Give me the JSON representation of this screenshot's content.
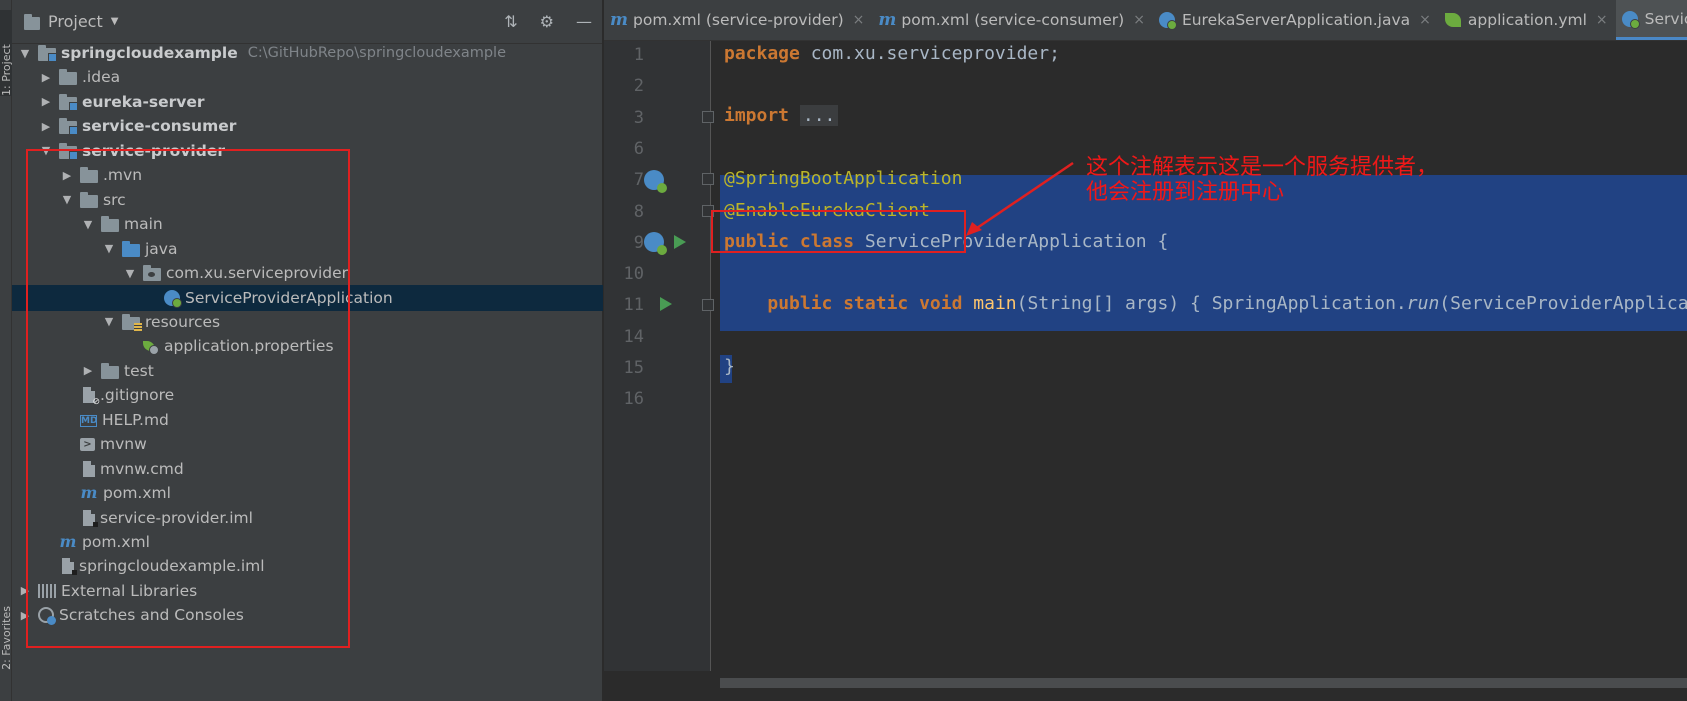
{
  "side_strip": {
    "project_tab": "1: Project",
    "favorites_tab": "2: Favorites"
  },
  "project_panel": {
    "title": "Project",
    "tree": [
      {
        "depth": 0,
        "arrow": "down",
        "icon": "folder-module",
        "label": "springcloudexample",
        "bold": true,
        "path": "C:\\GitHubRepo\\springcloudexample"
      },
      {
        "depth": 1,
        "arrow": "right",
        "icon": "folder",
        "label": ".idea"
      },
      {
        "depth": 1,
        "arrow": "right",
        "icon": "folder-module",
        "label": "eureka-server",
        "bold": true
      },
      {
        "depth": 1,
        "arrow": "right",
        "icon": "folder-module",
        "label": "service-consumer",
        "bold": true
      },
      {
        "depth": 1,
        "arrow": "down",
        "icon": "folder-module",
        "label": "service-provider",
        "bold": true
      },
      {
        "depth": 2,
        "arrow": "right",
        "icon": "folder",
        "label": ".mvn"
      },
      {
        "depth": 2,
        "arrow": "down",
        "icon": "folder",
        "label": "src"
      },
      {
        "depth": 3,
        "arrow": "down",
        "icon": "folder",
        "label": "main"
      },
      {
        "depth": 4,
        "arrow": "down",
        "icon": "folder-blue",
        "label": "java"
      },
      {
        "depth": 5,
        "arrow": "down",
        "icon": "folder-package",
        "label": "com.xu.serviceprovider"
      },
      {
        "depth": 6,
        "arrow": "",
        "icon": "spring",
        "label": "ServiceProviderApplication",
        "selected": true
      },
      {
        "depth": 4,
        "arrow": "down",
        "icon": "folder-resources",
        "label": "resources"
      },
      {
        "depth": 5,
        "arrow": "",
        "icon": "leaf",
        "label": "application.properties"
      },
      {
        "depth": 3,
        "arrow": "right",
        "icon": "folder",
        "label": "test"
      },
      {
        "depth": 2,
        "arrow": "",
        "icon": "file-git",
        "label": ".gitignore"
      },
      {
        "depth": 2,
        "arrow": "",
        "icon": "md",
        "label": "HELP.md"
      },
      {
        "depth": 2,
        "arrow": "",
        "icon": "terminal",
        "label": "mvnw"
      },
      {
        "depth": 2,
        "arrow": "",
        "icon": "file",
        "label": "mvnw.cmd"
      },
      {
        "depth": 2,
        "arrow": "",
        "icon": "maven",
        "label": "pom.xml"
      },
      {
        "depth": 2,
        "arrow": "",
        "icon": "file-iml",
        "label": "service-provider.iml"
      },
      {
        "depth": 1,
        "arrow": "",
        "icon": "maven",
        "label": "pom.xml"
      },
      {
        "depth": 1,
        "arrow": "",
        "icon": "file-iml",
        "label": "springcloudexample.iml"
      },
      {
        "depth": 0,
        "arrow": "right",
        "icon": "library",
        "label": "External Libraries"
      },
      {
        "depth": 0,
        "arrow": "right",
        "icon": "scratch",
        "label": "Scratches and Consoles"
      }
    ]
  },
  "tabs": [
    {
      "icon": "maven",
      "label": "pom.xml (service-provider)",
      "close": "×"
    },
    {
      "icon": "maven",
      "label": "pom.xml (service-consumer)",
      "close": "×"
    },
    {
      "icon": "spring",
      "label": "EurekaServerApplication.java",
      "close": "×"
    },
    {
      "icon": "leaf",
      "label": "application.yml",
      "close": "×"
    },
    {
      "icon": "spring",
      "label": "ServiceProviderApplication.java",
      "close": "×",
      "active": true
    }
  ],
  "editor": {
    "line_numbers": [
      "1",
      "2",
      "3",
      "6",
      "7",
      "8",
      "9",
      "10",
      "11",
      "14",
      "15",
      "16"
    ],
    "code": {
      "package_kw": "package",
      "package_name": " com.xu.serviceprovider;",
      "import_kw": "import",
      "import_fold": "...",
      "ann1": "@SpringBootApplication",
      "ann2": "@EnableEurekaClient",
      "class_kw": "public class",
      "class_name": " ServiceProviderApplication {",
      "main_kw": "public static void",
      "main_fn": "main",
      "main_params": "(String[] args) ",
      "main_body_open": "{ SpringApplication.",
      "main_run": "run",
      "main_rest": "(ServiceProviderApplication.class, args); }",
      "close_brace": "}"
    }
  },
  "annotation_note": {
    "line1": "这个注解表示这是一个服务提供者，",
    "line2": "他会注册到注册中心"
  },
  "colors": {
    "red_highlight": "#e02020",
    "selection": "#214283",
    "keyword": "#cc7832",
    "annotation": "#bbb529"
  }
}
